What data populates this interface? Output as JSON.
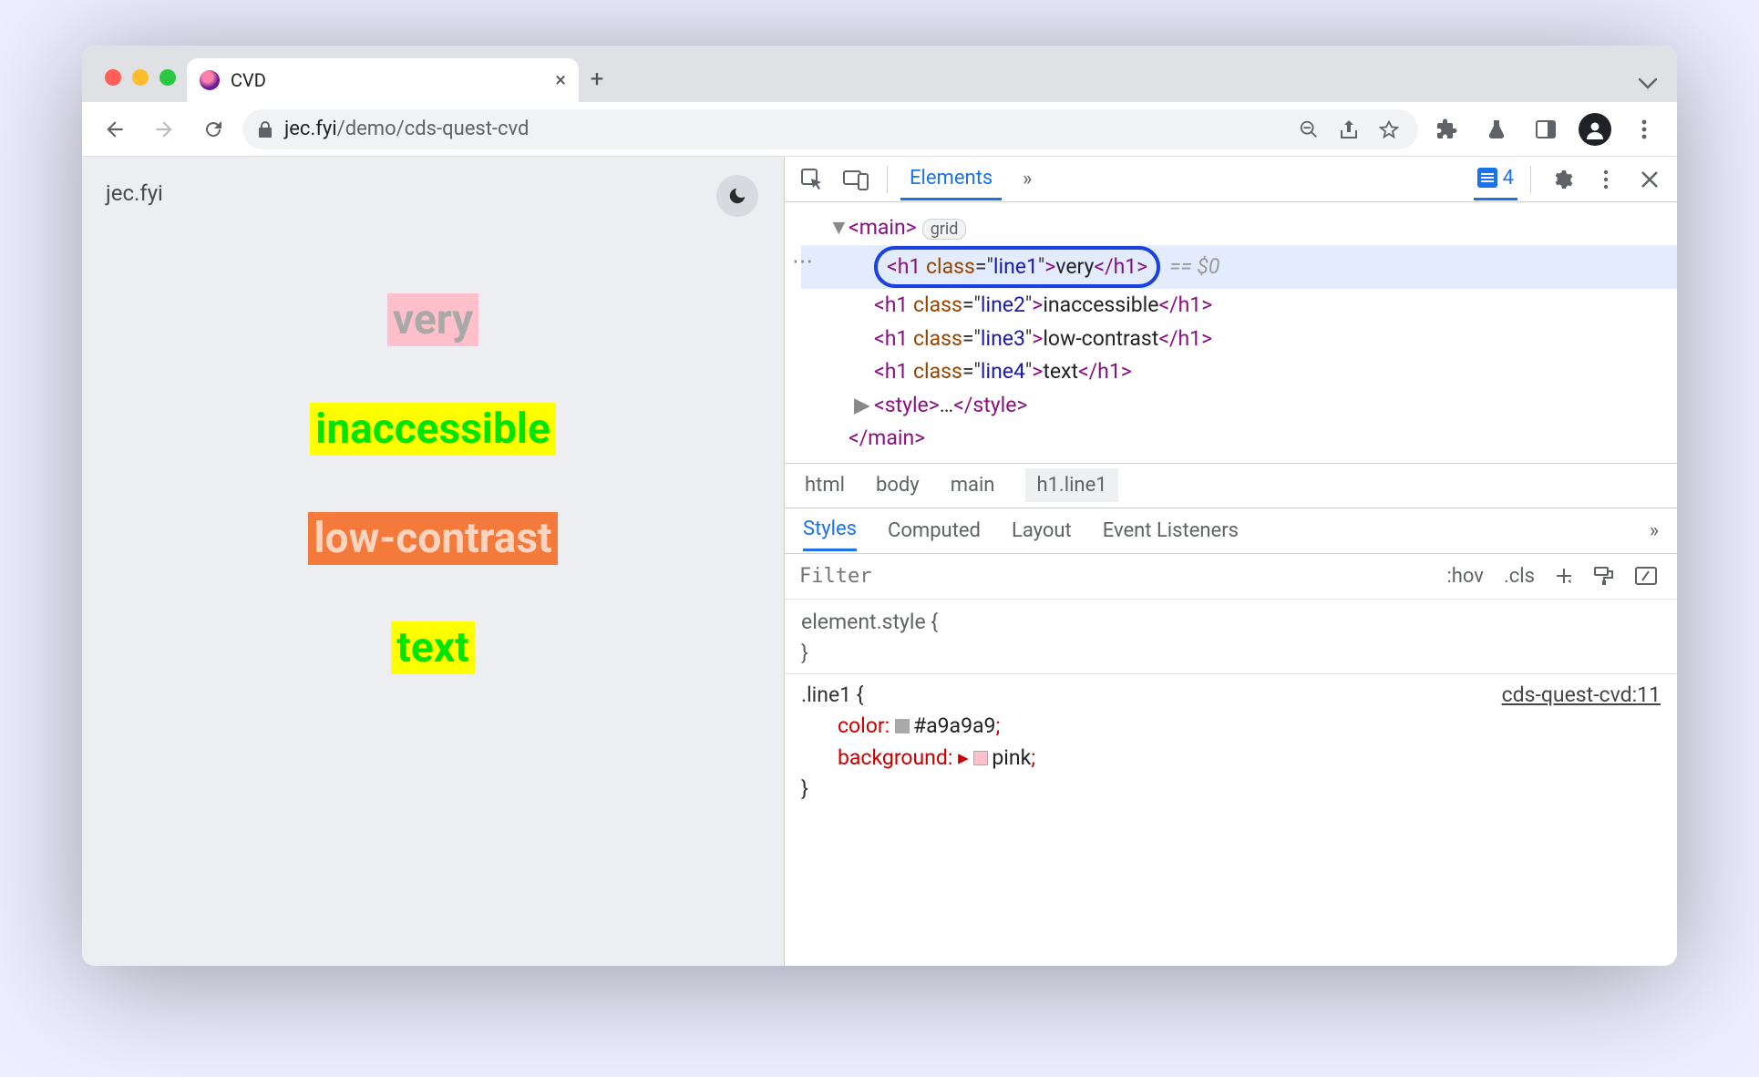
{
  "tab": {
    "title": "CVD"
  },
  "url": {
    "host": "jec.fyi",
    "path": "/demo/cds-quest-cvd"
  },
  "page": {
    "heading": "jec.fyi",
    "words": [
      "very",
      "inaccessible",
      "low-contrast",
      "text"
    ]
  },
  "devtools": {
    "panel": "Elements",
    "issues_count": "4",
    "dom": {
      "main_badge": "grid",
      "lines": [
        {
          "cls": "line1",
          "txt": "very"
        },
        {
          "cls": "line2",
          "txt": "inaccessible"
        },
        {
          "cls": "line3",
          "txt": "low-contrast"
        },
        {
          "cls": "line4",
          "txt": "text"
        }
      ],
      "selected_suffix": "== $0"
    },
    "breadcrumbs": [
      "html",
      "body",
      "main",
      "h1.line1"
    ],
    "sub_tabs": [
      "Styles",
      "Computed",
      "Layout",
      "Event Listeners"
    ],
    "filter": {
      "placeholder": "Filter",
      "hov": ":hov",
      "cls": ".cls"
    },
    "styles": {
      "element_style": "element.style {",
      "rule_selector": ".line1 {",
      "source_link": "cds-quest-cvd:11",
      "props": [
        {
          "name": "color",
          "value": "#a9a9a9",
          "swatch": "sw-gray",
          "prefix": ""
        },
        {
          "name": "background",
          "value": "pink",
          "swatch": "sw-pink",
          "prefix": "▸ "
        }
      ]
    }
  }
}
